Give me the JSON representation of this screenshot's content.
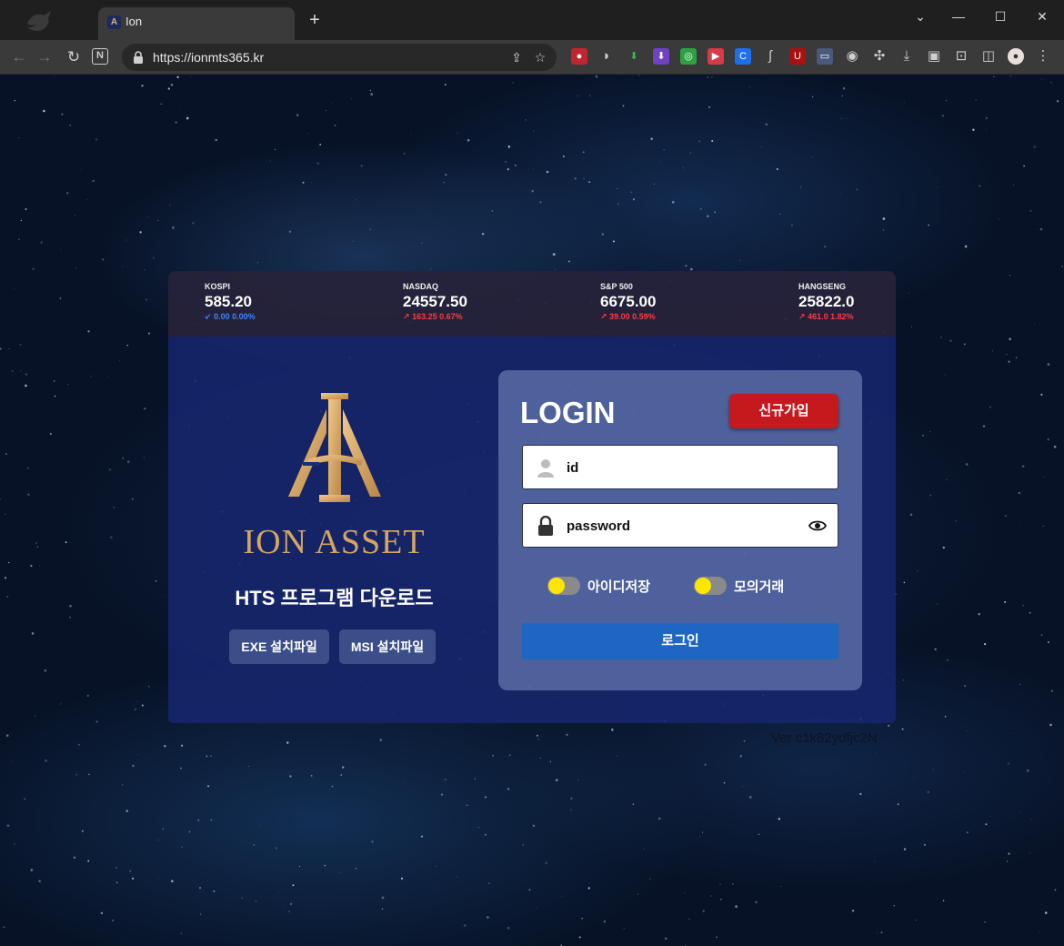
{
  "browser": {
    "tab_title": "Ion",
    "url": "https://ionmts365.kr",
    "new_tab": "+",
    "window_controls": {
      "chevron": "⌄",
      "minimize": "—",
      "maximize": "☐",
      "close": "✕"
    }
  },
  "ticker": [
    {
      "name": "KOSPI",
      "value": "585.20",
      "change": "0.00 0.00%",
      "direction": "down",
      "arrow": "↙"
    },
    {
      "name": "NASDAQ",
      "value": "24557.50",
      "change": "163.25 0.67%",
      "direction": "up",
      "arrow": "↗"
    },
    {
      "name": "S&P 500",
      "value": "6675.00",
      "change": "39.00 0.59%",
      "direction": "up",
      "arrow": "↗"
    },
    {
      "name": "HANGSENG",
      "value": "25822.0",
      "change": "461.0 1.82%",
      "direction": "up",
      "arrow": "↗"
    }
  ],
  "brand": {
    "name": "ION ASSET",
    "subtitle": "HTS 프로그램 다운로드",
    "exe_button": "EXE 설치파일",
    "msi_button": "MSI 설치파일"
  },
  "login": {
    "title": "LOGIN",
    "signup_button": "신규가입",
    "id_placeholder": "id",
    "password_placeholder": "password",
    "save_id_label": "아이디저장",
    "mock_trade_label": "모의거래",
    "login_button": "로그인"
  },
  "version": "Ver c1k82ydfjc2N",
  "colors": {
    "accent_gold": "#d6a462",
    "signup_red": "#c41a1e",
    "login_blue": "#1f66c2",
    "toggle_yellow": "#ffe600",
    "down_blue": "#3b86ff",
    "up_red": "#ff3b3b"
  }
}
